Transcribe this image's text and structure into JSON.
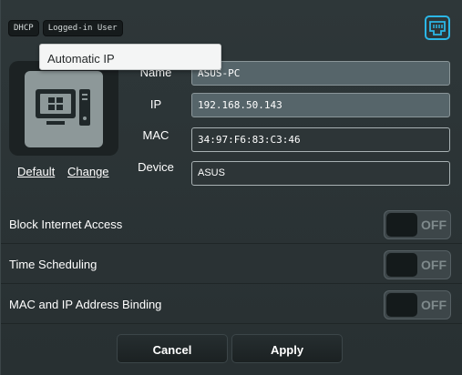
{
  "tags": [
    "DHCP",
    "Logged-in User"
  ],
  "dropdown": {
    "selected": "Automatic IP"
  },
  "device_links": {
    "default": "Default",
    "change": "Change"
  },
  "fields": {
    "name": {
      "label": "Name",
      "value": "ASUS-PC"
    },
    "ip": {
      "label": "IP",
      "value": "192.168.50.143"
    },
    "mac": {
      "label": "MAC",
      "value": "34:97:F6:83:C3:46"
    },
    "device": {
      "label": "Device",
      "value": "ASUS"
    }
  },
  "settings": [
    {
      "label": "Block Internet Access",
      "state": "OFF"
    },
    {
      "label": "Time Scheduling",
      "state": "OFF"
    },
    {
      "label": "MAC and IP Address Binding",
      "state": "OFF"
    }
  ],
  "buttons": {
    "cancel": "Cancel",
    "apply": "Apply"
  },
  "colors": {
    "accent": "#2bb6e6",
    "panel": "#2b3436"
  },
  "icons": {
    "network": "lan-port-icon",
    "device": "windows-pc-icon"
  }
}
